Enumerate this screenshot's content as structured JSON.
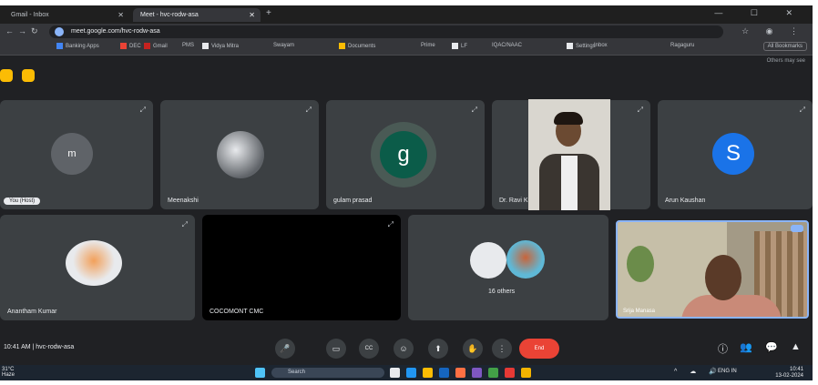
{
  "browser": {
    "tabs": [
      {
        "label": "Gmail - Inbox"
      },
      {
        "label": "Meet - hvc-rodw-asa"
      }
    ],
    "new_tab": "+",
    "window_controls": "— ☐ ✕",
    "url": "meet.google.com/hvc-rodw-asa",
    "bookmarks": [
      "Banking Apps",
      "DEC",
      "Gmail",
      "PMS",
      "Vidya Mitra",
      "Swayam",
      "Documents",
      "Prime",
      "LF",
      "IQAC/NAAC",
      "Settings",
      "Inbox",
      "Ragaguru"
    ],
    "all_bookmarks": "All Bookmarks"
  },
  "meet": {
    "top_note": "Others may see",
    "tiles": [
      {
        "name": "",
        "self_label": "You (Host)",
        "avatar_letter": "m",
        "avatar_color": "#5f6368"
      },
      {
        "name": "Meenakshi",
        "avatar_letter": "",
        "avatar_color": "#8b8f96"
      },
      {
        "name": "gulam prasad",
        "avatar_letter": "g",
        "avatar_color": "#0b5c49"
      },
      {
        "name": "Dr. Ravi Kumar",
        "avatar_letter": "",
        "avatar_color": "#3c4043"
      },
      {
        "name": "Arun Kaushan",
        "avatar_letter": "S",
        "avatar_color": "#1a73e8"
      },
      {
        "name": "Anantham Kumar",
        "avatar_letter": "",
        "avatar_color": "#e8eaed"
      },
      {
        "name": "COCOMONT CMC",
        "avatar_letter": "",
        "avatar_color": "#000000"
      },
      {
        "name": "16 others",
        "avatar_letter": "",
        "avatar_color": "#3c4043"
      },
      {
        "name": "Srija Manasa",
        "avatar_letter": "",
        "avatar_color": "#a39a86"
      }
    ],
    "time_and_code": "10:41 AM  |  hvc-rodw-asa",
    "controls": {
      "mic": "🎤",
      "camera": "▭",
      "captions": "CC",
      "emoji": "☺",
      "present": "⬆",
      "hand": "✋",
      "more": "⋮",
      "end_call": "End"
    },
    "right_controls": [
      "ⓘ",
      "👥",
      "💬",
      "▲"
    ]
  },
  "taskbar": {
    "weather_temp": "31°C",
    "weather_desc": "Haze",
    "search_placeholder": "Search",
    "tray_lang": "ENG IN",
    "clock_time": "10:41",
    "clock_date": "13-02-2024"
  }
}
